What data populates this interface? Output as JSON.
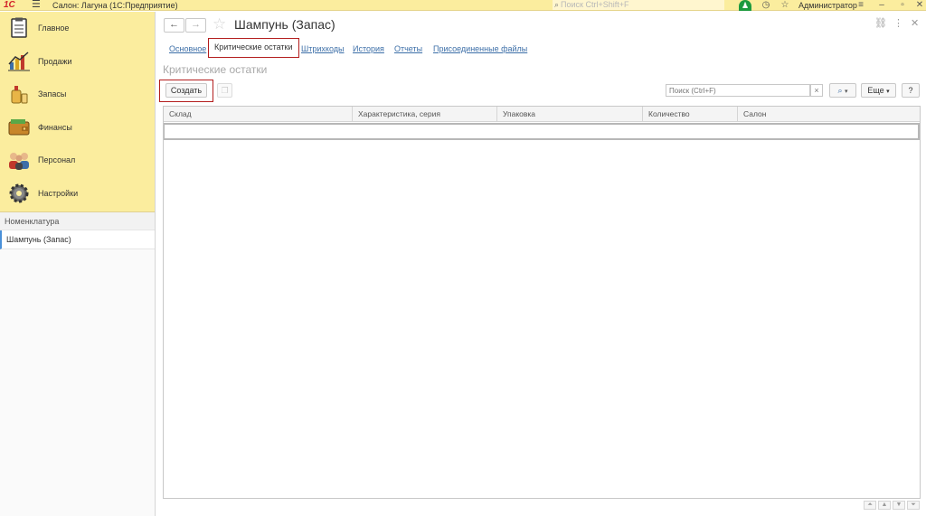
{
  "titlebar": {
    "logo": "1С",
    "app_title": "Салон: Лагуна  (1С:Предприятие)",
    "search_placeholder": "Поиск Ctrl+Shift+F",
    "user": "Администратор"
  },
  "sidebar": {
    "sections": [
      {
        "label": "Главное",
        "icon": "main-icon"
      },
      {
        "label": "Продажи",
        "icon": "sales-chart-icon"
      },
      {
        "label": "Запасы",
        "icon": "stock-icon"
      },
      {
        "label": "Финансы",
        "icon": "wallet-icon"
      },
      {
        "label": "Персонал",
        "icon": "people-icon"
      },
      {
        "label": "Настройки",
        "icon": "gear-icon"
      }
    ],
    "nav_header": "Номенклатура",
    "nav_item": "Шампунь (Запас)"
  },
  "form": {
    "title": "Шампунь (Запас)",
    "tabs": [
      {
        "label": "Основное"
      },
      {
        "label": "Критические остатки"
      },
      {
        "label": "Штрихкоды"
      },
      {
        "label": "История"
      },
      {
        "label": "Отчеты"
      },
      {
        "label": "Присоединенные файлы"
      }
    ],
    "section_title": "Критические остатки"
  },
  "toolbar": {
    "create_label": "Создать",
    "search_placeholder": "Поиск (Ctrl+F)",
    "more_label": "Еще",
    "help_label": "?"
  },
  "table": {
    "columns": [
      "Склад",
      "Характеристика, серия",
      "Упаковка",
      "Количество",
      "Салон"
    ],
    "rows": []
  }
}
